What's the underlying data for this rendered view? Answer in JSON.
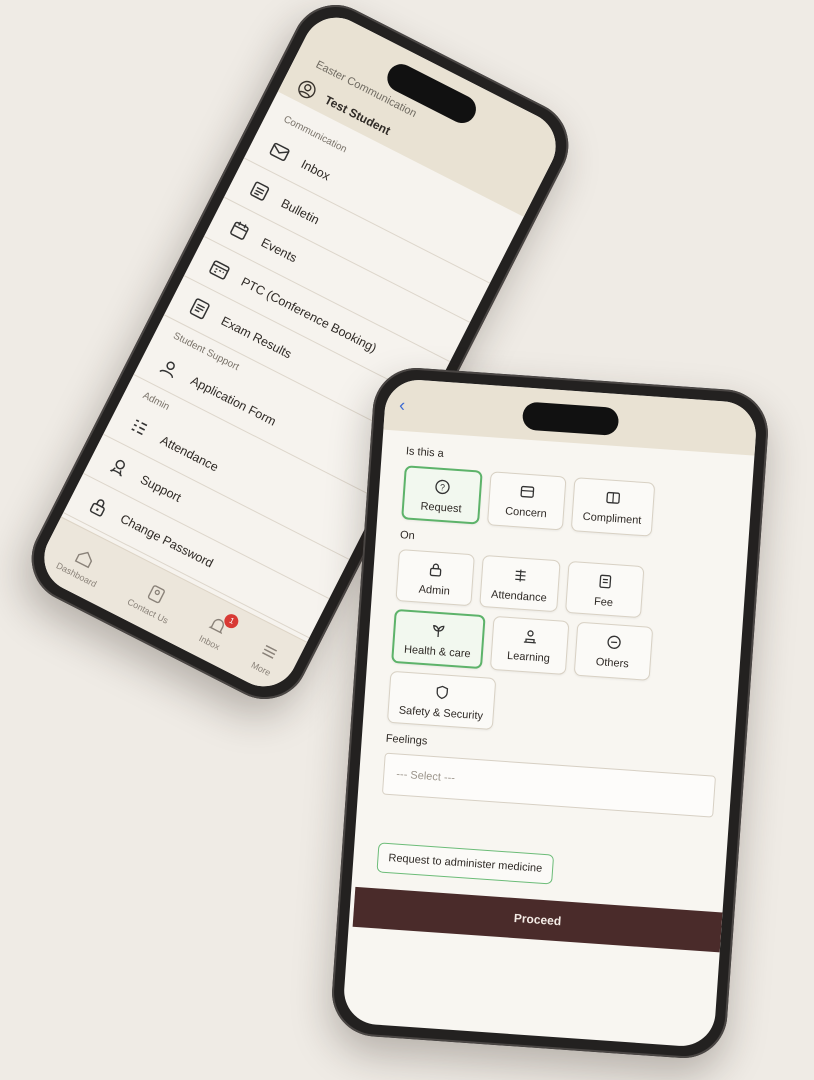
{
  "menu_phone": {
    "header_title": "Easter Communication",
    "profile_name": "Test Student",
    "sections": [
      {
        "label": "Communication",
        "items": [
          {
            "label": "Inbox",
            "icon": "inbox-icon"
          },
          {
            "label": "Bulletin",
            "icon": "bulletin-icon"
          },
          {
            "label": "Events",
            "icon": "events-icon"
          },
          {
            "label": "PTC (Conference Booking)",
            "icon": "calendar-icon"
          },
          {
            "label": "Exam Results",
            "icon": "results-icon"
          }
        ]
      },
      {
        "label": "Student Support",
        "items": [
          {
            "label": "Application Form",
            "icon": "application-icon"
          }
        ]
      },
      {
        "label": "Admin",
        "items": [
          {
            "label": "Attendance",
            "icon": "attendance-icon"
          },
          {
            "label": "Support",
            "icon": "support-icon"
          },
          {
            "label": "Change Password",
            "icon": "lock-icon"
          }
        ]
      }
    ],
    "tabbar": [
      {
        "label": "Dashboard",
        "icon": "home-icon"
      },
      {
        "label": "Contact Us",
        "icon": "contact-icon"
      },
      {
        "label": "Inbox",
        "icon": "bell-icon",
        "badge": "1"
      },
      {
        "label": "More",
        "icon": "menu-icon"
      }
    ]
  },
  "form_phone": {
    "q1_label": "Is this a",
    "q1_options": [
      {
        "label": "Request",
        "icon": "question-icon",
        "selected": true
      },
      {
        "label": "Concern",
        "icon": "concern-icon",
        "selected": false
      },
      {
        "label": "Compliment",
        "icon": "compliment-icon",
        "selected": false
      }
    ],
    "q2_label": "On",
    "q2_options": [
      {
        "label": "Admin",
        "icon": "admin-icon",
        "selected": false
      },
      {
        "label": "Attendance",
        "icon": "attendance-icon",
        "selected": false
      },
      {
        "label": "Fee",
        "icon": "fee-icon",
        "selected": false
      },
      {
        "label": "Health & care",
        "icon": "health-icon",
        "selected": true
      },
      {
        "label": "Learning",
        "icon": "learning-icon",
        "selected": false
      },
      {
        "label": "Others",
        "icon": "others-icon",
        "selected": false
      },
      {
        "label": "Safety & Security",
        "icon": "shield-icon",
        "selected": false
      }
    ],
    "feelings_label": "Feelings",
    "feelings_placeholder": "--- Select ---",
    "subject_value": "Request to administer medicine",
    "proceed_label": "Proceed"
  },
  "colors": {
    "background": "#efebe5",
    "header": "#e9e2d3",
    "selected_border": "#5db36a",
    "proceed": "#4a2b2a",
    "badge": "#d83a35"
  }
}
